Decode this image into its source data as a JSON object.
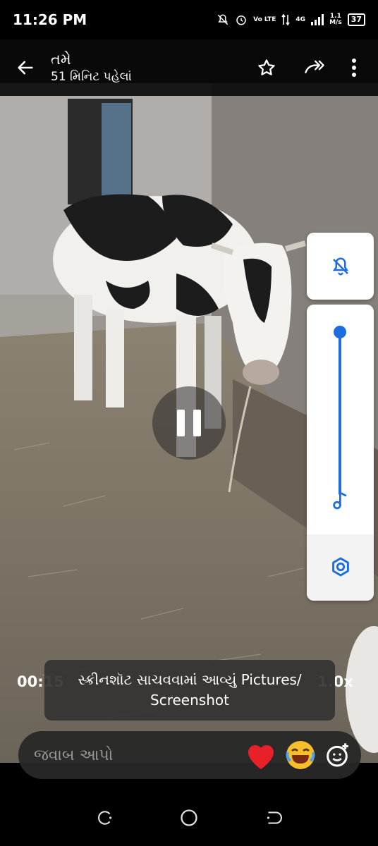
{
  "status_bar": {
    "time": "11:26 PM",
    "network": "4G",
    "speed_top": "1.1",
    "speed_bottom": "M/s",
    "volte": "Vo LTE",
    "battery": "37"
  },
  "header": {
    "title": "તમે",
    "subtitle": "51 મિનિટ પહેલાં"
  },
  "player": {
    "time_label": "00:15",
    "speed_label": "1.0x"
  },
  "volume_panel": {
    "level": 1.0,
    "accent_color": "#1e6de0"
  },
  "toast": {
    "line1": "સ્ક્રીનશૉટ સાચવવામાં આવ્યું  Pictures/",
    "line2": "Screenshot"
  },
  "reply": {
    "placeholder": "જવાબ આપો",
    "reactions": [
      "heart",
      "laughing-emoji"
    ]
  }
}
